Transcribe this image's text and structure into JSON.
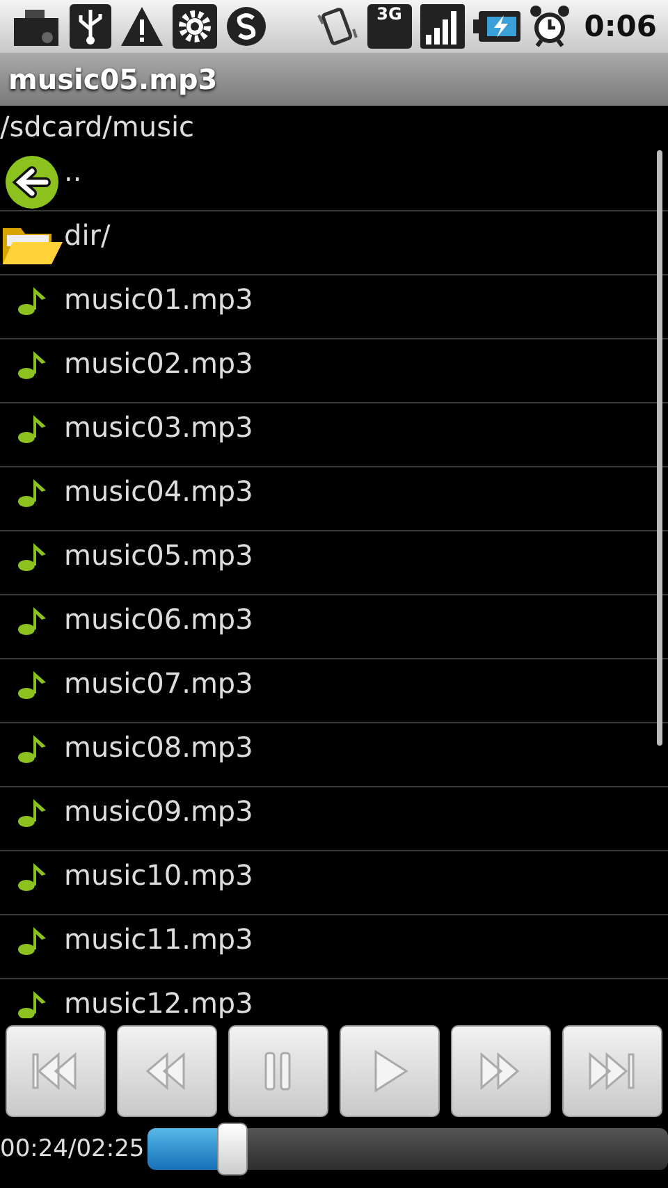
{
  "status_bar": {
    "network": "3G",
    "time": "0:06"
  },
  "title": "music05.mp3",
  "path": "/sdcard/music",
  "items": [
    {
      "kind": "up",
      "label": ".."
    },
    {
      "kind": "folder",
      "label": "dir/"
    },
    {
      "kind": "file",
      "label": "music01.mp3"
    },
    {
      "kind": "file",
      "label": "music02.mp3"
    },
    {
      "kind": "file",
      "label": "music03.mp3"
    },
    {
      "kind": "file",
      "label": "music04.mp3"
    },
    {
      "kind": "file",
      "label": "music05.mp3"
    },
    {
      "kind": "file",
      "label": "music06.mp3"
    },
    {
      "kind": "file",
      "label": "music07.mp3"
    },
    {
      "kind": "file",
      "label": "music08.mp3"
    },
    {
      "kind": "file",
      "label": "music09.mp3"
    },
    {
      "kind": "file",
      "label": "music10.mp3"
    },
    {
      "kind": "file",
      "label": "music11.mp3"
    },
    {
      "kind": "file",
      "label": "music12.mp3"
    }
  ],
  "controls": [
    {
      "kind": "first"
    },
    {
      "kind": "rewind"
    },
    {
      "kind": "pause"
    },
    {
      "kind": "play"
    },
    {
      "kind": "forward"
    },
    {
      "kind": "last"
    }
  ],
  "progress": {
    "time": "00:24/02:25",
    "level": 0.165
  }
}
